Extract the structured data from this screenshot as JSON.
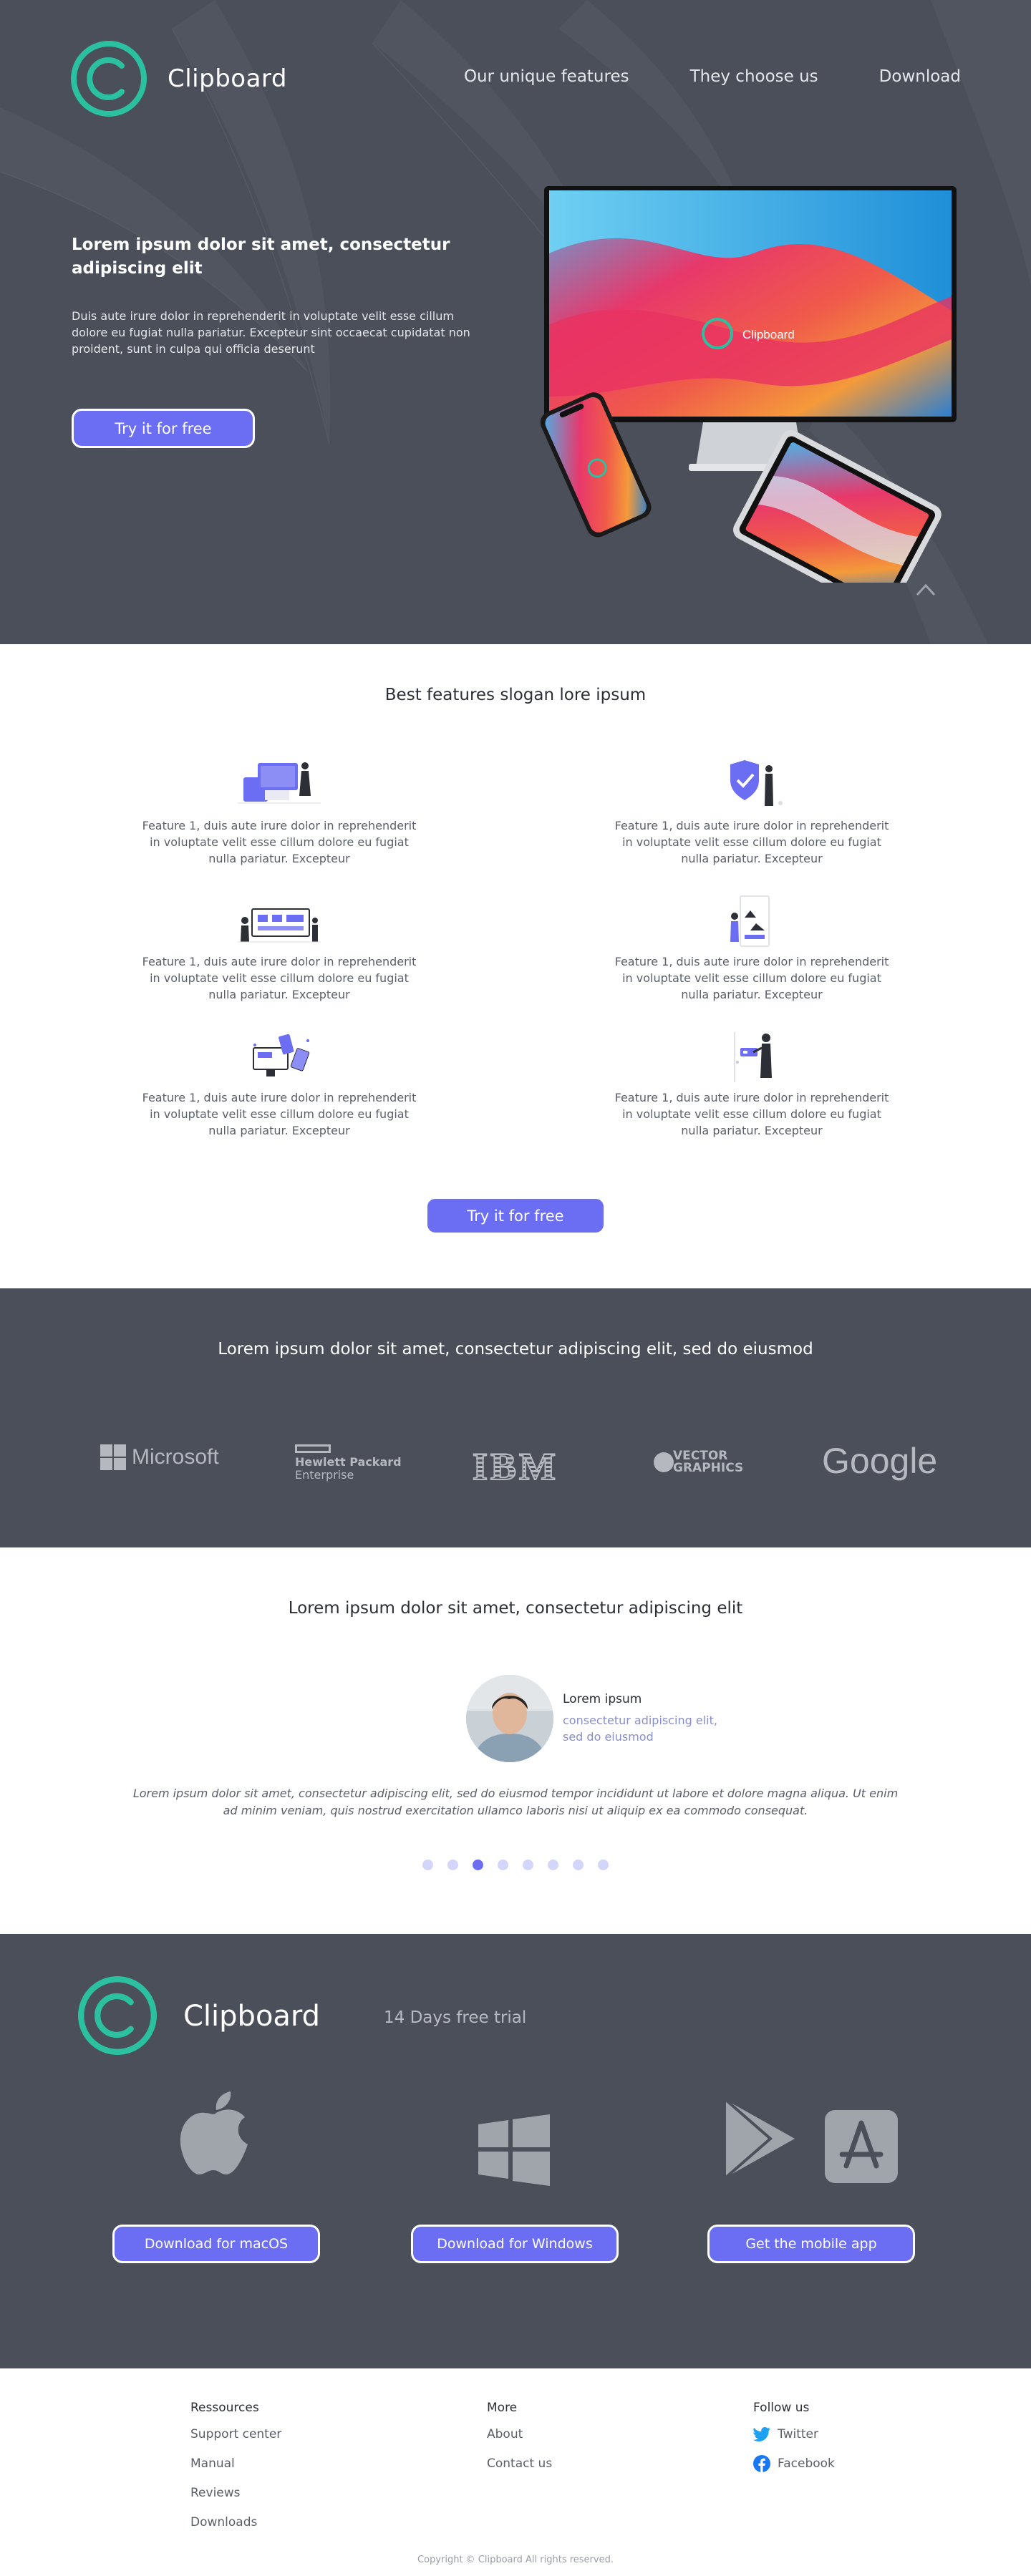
{
  "header": {
    "brand": "Clipboard",
    "nav": [
      "Our unique features",
      "They choose us",
      "Download"
    ]
  },
  "hero": {
    "title": "Lorem ipsum dolor sit amet, consectetur adipiscing elit",
    "text": "Duis aute irure dolor in reprehenderit in voluptate velit esse cillum dolore eu fugiat nulla pariatur. Excepteur sint occaecat cupidatat non proident, sunt in culpa qui officia deserunt",
    "cta": "Try it for free",
    "screen_brand": "Clipboard"
  },
  "features": {
    "title": "Best features slogan lore ipsum",
    "items": [
      {
        "text": "Feature 1, duis aute irure dolor in reprehenderit in voluptate velit esse cillum dolore eu fugiat nulla pariatur. Excepteur",
        "icon": "devices-illustration-icon"
      },
      {
        "text": "Feature 1, duis aute irure dolor in reprehenderit in voluptate velit esse cillum dolore eu fugiat nulla pariatur. Excepteur",
        "icon": "security-shield-illustration-icon"
      },
      {
        "text": "Feature 1, duis aute irure dolor in reprehenderit in voluptate velit esse cillum dolore eu fugiat nulla pariatur. Excepteur",
        "icon": "dashboard-illustration-icon"
      },
      {
        "text": "Feature 1, duis aute irure dolor in reprehenderit in voluptate velit esse cillum dolore eu fugiat nulla pariatur. Excepteur",
        "icon": "gallery-illustration-icon"
      },
      {
        "text": "Feature 1, duis aute irure dolor in reprehenderit in voluptate velit esse cillum dolore eu fugiat nulla pariatur. Excepteur",
        "icon": "sync-devices-illustration-icon"
      },
      {
        "text": "Feature 1, duis aute irure dolor in reprehenderit in voluptate velit esse cillum dolore eu fugiat nulla pariatur. Excepteur",
        "icon": "presentation-illustration-icon"
      }
    ],
    "cta": "Try it for free"
  },
  "partners": {
    "title": "Lorem ipsum dolor sit amet, consectetur adipiscing elit, sed do eiusmod",
    "logos": {
      "microsoft": "Microsoft",
      "hpe_line1": "Hewlett Packard",
      "hpe_line2": "Enterprise",
      "ibm": "IBM",
      "vector_line1": "VECTOR",
      "vector_line2": "GRAPHICS",
      "google": "Google"
    }
  },
  "testimonial": {
    "title": "Lorem ipsum dolor sit amet, consectetur adipiscing elit",
    "name": "Lorem ipsum",
    "role": "consectetur adipiscing elit, sed do eiusmod",
    "quote": "Lorem ipsum dolor sit amet, consectetur adipiscing elit, sed do eiusmod tempor incididunt ut labore et dolore magna aliqua. Ut enim ad minim veniam, quis nostrud exercitation ullamco laboris nisi ut aliquip ex ea commodo consequat.",
    "dots_total": 8,
    "active_dot": 3
  },
  "download": {
    "brand": "Clipboard",
    "trial": "14 Days free trial",
    "mac": "Download for macOS",
    "windows": "Download for Windows",
    "mobile": "Get the mobile app"
  },
  "footer": {
    "col1": {
      "title": "Ressources",
      "links": [
        "Support center",
        "Manual",
        "Reviews",
        "Downloads"
      ]
    },
    "col2": {
      "title": "More",
      "links": [
        "About",
        "Contact us"
      ]
    },
    "col3": {
      "title": "Follow us",
      "links": [
        "Twitter",
        "Facebook"
      ]
    },
    "copyright": "Copyright © Clipboard All rights reserved."
  },
  "colors": {
    "accent": "#6b6df2",
    "teal": "#2bc0a0",
    "dark_bg": "#4a4f59"
  }
}
